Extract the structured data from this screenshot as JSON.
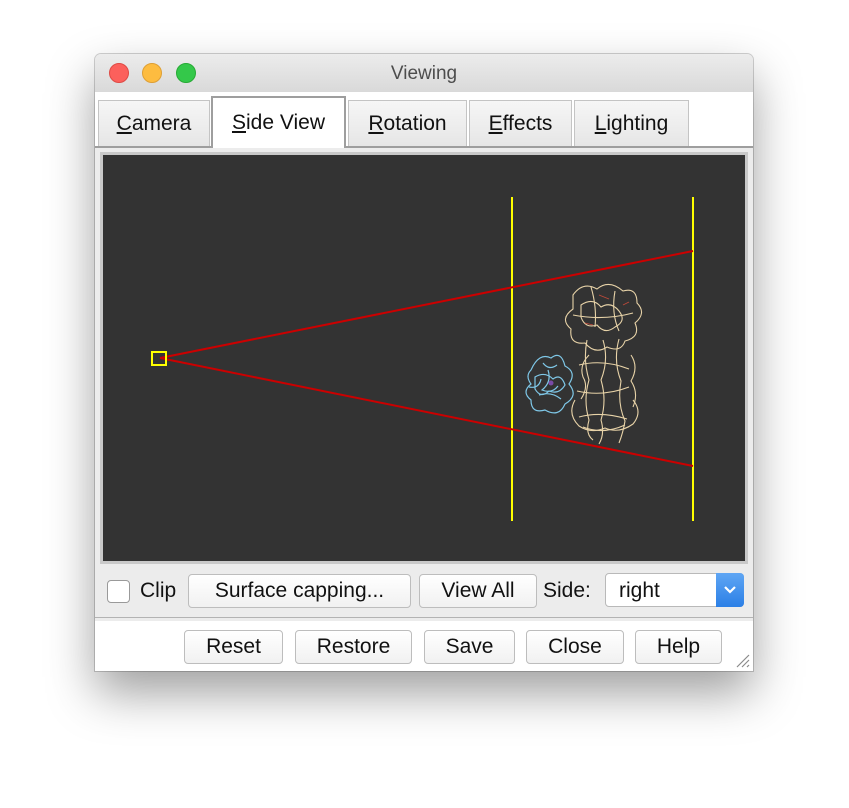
{
  "window": {
    "title": "Viewing"
  },
  "tabs": [
    {
      "mnemonic": "C",
      "rest": "amera",
      "active": false
    },
    {
      "mnemonic": "S",
      "rest": "ide View",
      "active": true
    },
    {
      "mnemonic": "R",
      "rest": "otation",
      "active": false
    },
    {
      "mnemonic": "E",
      "rest": "ffects",
      "active": false
    },
    {
      "mnemonic": "L",
      "rest": "ighting",
      "active": false
    }
  ],
  "controls": {
    "clip_label": "Clip",
    "clip_checked": false,
    "surface_capping_label": "Surface capping...",
    "view_all_label": "View All",
    "side_label": "Side:",
    "side_value": "right"
  },
  "buttons": {
    "reset": "Reset",
    "restore": "Restore",
    "save": "Save",
    "close": "Close",
    "help": "Help"
  },
  "colors": {
    "canvas_background": "#333333",
    "clip_planes": "#ffff00",
    "view_frustum": "#cc0000",
    "eye_marker": "#ffff00",
    "protein_main": "#e8d3a8",
    "protein_ligand": "#7fc8e8",
    "select_accent": "#2b7fe6"
  },
  "icons": {
    "eye_marker": "eye-position-square",
    "select_arrow": "chevron-down-icon",
    "resize": "resize-grip-icon"
  }
}
